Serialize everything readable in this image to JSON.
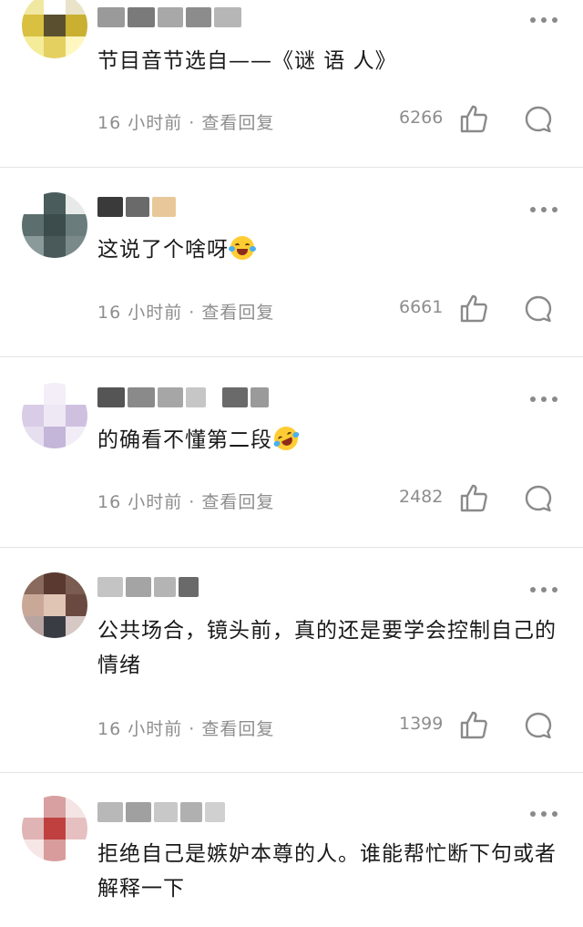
{
  "comments": [
    {
      "text": "节目音节选自——《谜 语 人》",
      "time": "16 小时前",
      "sep": "·",
      "reply_label": "查看回复",
      "likes": "6266",
      "emoji": ""
    },
    {
      "text": "这说了个啥呀",
      "time": "16 小时前",
      "sep": "·",
      "reply_label": "查看回复",
      "likes": "6661",
      "emoji": "crying-laughing-emoji"
    },
    {
      "text": "的确看不懂第二段",
      "time": "16 小时前",
      "sep": "·",
      "reply_label": "查看回复",
      "likes": "2482",
      "emoji": "rolling-laughing-emoji"
    },
    {
      "text": "公共场合，镜头前，真的还是要学会控制自己的情绪",
      "time": "16 小时前",
      "sep": "·",
      "reply_label": "查看回复",
      "likes": "1399",
      "emoji": ""
    },
    {
      "text": "拒绝自己是嫉妒本尊的人。谁能帮忙断下句或者解释一下",
      "time": "",
      "sep": "",
      "reply_label": "",
      "likes": "",
      "emoji": ""
    }
  ],
  "colors": {
    "text": "#1a1a1a",
    "meta": "#8d8d8d",
    "divider": "#e3e3e3",
    "icon": "#8a8a8a"
  }
}
